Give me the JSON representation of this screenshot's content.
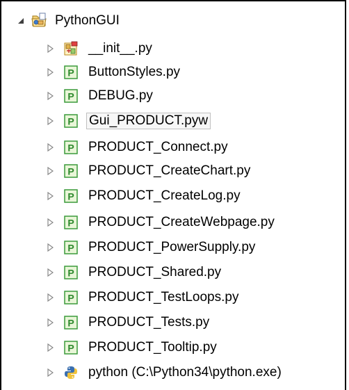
{
  "project": {
    "name": "PythonGUI",
    "expanded": true,
    "icon": "project-folder-icon"
  },
  "files": [
    {
      "label": "__init__.py",
      "icon": "init-module-icon"
    },
    {
      "label": "ButtonStyles.py",
      "icon": "python-file-icon"
    },
    {
      "label": "DEBUG.py",
      "icon": "python-file-icon"
    },
    {
      "label": "Gui_PRODUCT.pyw",
      "icon": "python-file-icon",
      "selected": true
    },
    {
      "label": "PRODUCT_Connect.py",
      "icon": "python-file-icon"
    },
    {
      "label": "PRODUCT_CreateChart.py",
      "icon": "python-file-icon"
    },
    {
      "label": "PRODUCT_CreateLog.py",
      "icon": "python-file-icon"
    },
    {
      "label": "PRODUCT_CreateWebpage.py",
      "icon": "python-file-icon"
    },
    {
      "label": "PRODUCT_PowerSupply.py",
      "icon": "python-file-icon"
    },
    {
      "label": "PRODUCT_Shared.py",
      "icon": "python-file-icon"
    },
    {
      "label": "PRODUCT_TestLoops.py",
      "icon": "python-file-icon"
    },
    {
      "label": "PRODUCT_Tests.py",
      "icon": "python-file-icon"
    },
    {
      "label": "PRODUCT_Tooltip.py",
      "icon": "python-file-icon"
    }
  ],
  "interpreter": {
    "label": "python  (C:\\Python34\\python.exe)",
    "icon": "python-interpreter-icon"
  },
  "colors": {
    "file_icon_green": "#3a9a3a",
    "file_icon_bg": "#e9f6d8",
    "selection_border": "#c0c0c0"
  }
}
